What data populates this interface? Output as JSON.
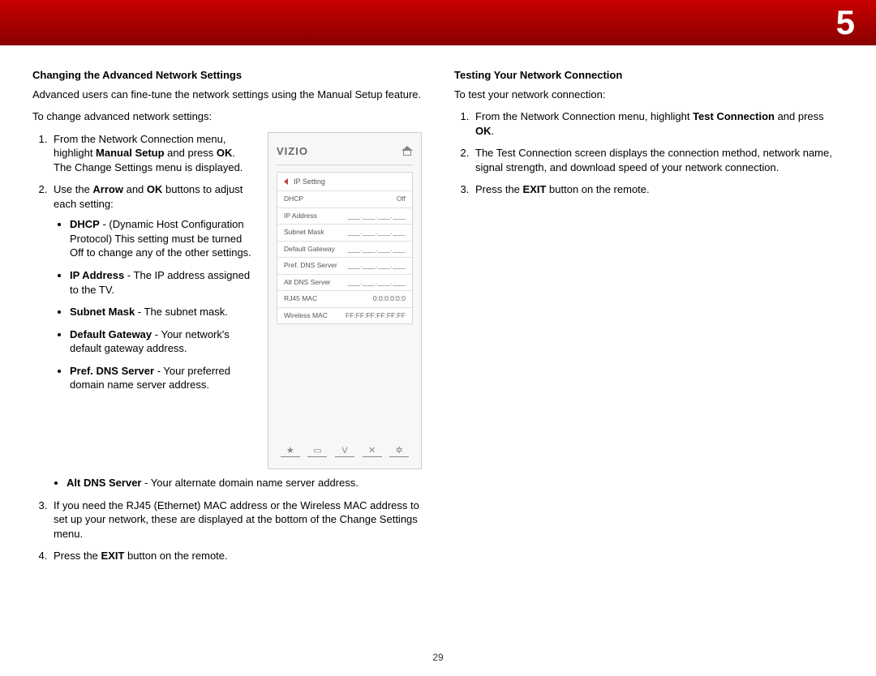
{
  "chapter_number": "5",
  "page_number": "29",
  "left": {
    "heading": "Changing the Advanced Network Settings",
    "intro": "Advanced users can fine-tune the network settings using the Manual Setup feature.",
    "lead": "To change advanced network settings:",
    "steps": {
      "s1_a": "From the Network Connection menu, highlight ",
      "s1_b": "Manual Setup",
      "s1_c": " and press ",
      "s1_d": "OK",
      "s1_e": ". The Change Settings menu is displayed.",
      "s2_a": "Use the ",
      "s2_b": "Arrow",
      "s2_c": " and ",
      "s2_d": "OK",
      "s2_e": " buttons to adjust each setting:",
      "bullets": {
        "dhcp_a": "DHCP",
        "dhcp_b": " - (Dynamic Host Configuration Protocol) This setting must be turned Off to change any of the other settings.",
        "ip_a": "IP Address",
        "ip_b": " - The IP address assigned to the TV.",
        "subnet_a": "Subnet Mask",
        "subnet_b": " - The subnet mask.",
        "gw_a": "Default Gateway",
        "gw_b": " - Your network's default gateway address.",
        "pref_a": "Pref. DNS Server",
        "pref_b": " - Your preferred domain name server address.",
        "alt_a": "Alt DNS Server",
        "alt_b": " - Your alternate domain name server address."
      },
      "s3": "If you need the RJ45 (Ethernet) MAC address or the Wireless MAC address to set up your network, these are displayed at the bottom of the Change Settings menu.",
      "s4_a": "Press the ",
      "s4_b": "EXIT",
      "s4_c": " button on the remote."
    }
  },
  "right": {
    "heading": "Testing Your Network Connection",
    "lead": "To test your network connection:",
    "steps": {
      "s1_a": "From the Network Connection menu, highlight ",
      "s1_b": "Test Connection",
      "s1_c": " and press ",
      "s1_d": "OK",
      "s1_e": ".",
      "s2": "The Test Connection screen displays the connection method, network name, signal strength, and download speed of your network connection.",
      "s3_a": "Press the ",
      "s3_b": "EXIT",
      "s3_c": " button on the remote."
    }
  },
  "mockup": {
    "logo": "VIZIO",
    "title": "IP Setting",
    "blank_ip": "___.___.___.___",
    "rows": [
      {
        "label": "DHCP",
        "value": "Off"
      },
      {
        "label": "IP Address",
        "value": "___.___.___.___"
      },
      {
        "label": "Subnet Mask",
        "value": "___.___.___.___"
      },
      {
        "label": "Default Gateway",
        "value": "___.___.___.___"
      },
      {
        "label": "Pref. DNS Server",
        "value": "___.___.___.___"
      },
      {
        "label": "Alt DNS Server",
        "value": "___.___.___.___"
      },
      {
        "label": "RJ45 MAC",
        "value": "0:0:0:0:0:0"
      },
      {
        "label": "Wireless MAC",
        "value": "FF:FF:FF:FF:FF:FF"
      }
    ],
    "icons": {
      "star": "★",
      "v": "V",
      "x": "✕",
      "gear": "✲"
    }
  }
}
